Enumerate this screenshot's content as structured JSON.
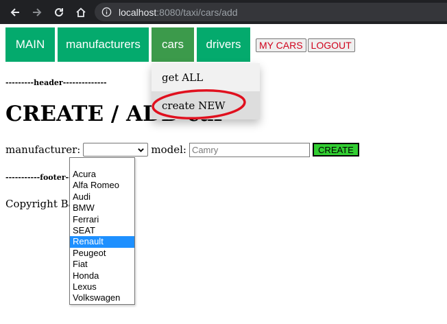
{
  "browser": {
    "url_host": "localhost",
    "url_rest": ":8080/taxi/cars/add"
  },
  "nav": {
    "tabs": [
      {
        "label": "MAIN"
      },
      {
        "label": "manufacturers"
      },
      {
        "label": "cars"
      },
      {
        "label": "drivers"
      }
    ],
    "my_cars_label": "MY CARS",
    "logout_label": "LOGOUT",
    "dropdown": [
      {
        "label": "get ALL"
      },
      {
        "label": "create NEW"
      }
    ]
  },
  "header_text": "---------header--------------",
  "page_title": "CREATE / ADD car",
  "form": {
    "manufacturer_label": "manufacturer:",
    "model_label": "model:",
    "model_placeholder": "Camry",
    "create_label": "CREATE",
    "options": [
      "",
      "Acura",
      "Alfa Romeo",
      "Audi",
      "BMW",
      "Ferrari",
      "SEAT",
      "Renault",
      "Peugeot",
      "Fiat",
      "Honda",
      "Lexus",
      "Volkswagen"
    ],
    "highlighted_option": "Renault"
  },
  "footer_text": "-----------footer-----------",
  "copyright": "Copyright Badikov",
  "colors": {
    "nav_green": "#04aa6d",
    "nav_active": "#3c9a4b",
    "create_green": "#32cd32",
    "annotation_red": "#e0101e",
    "select_highlight": "#1e90ff"
  }
}
